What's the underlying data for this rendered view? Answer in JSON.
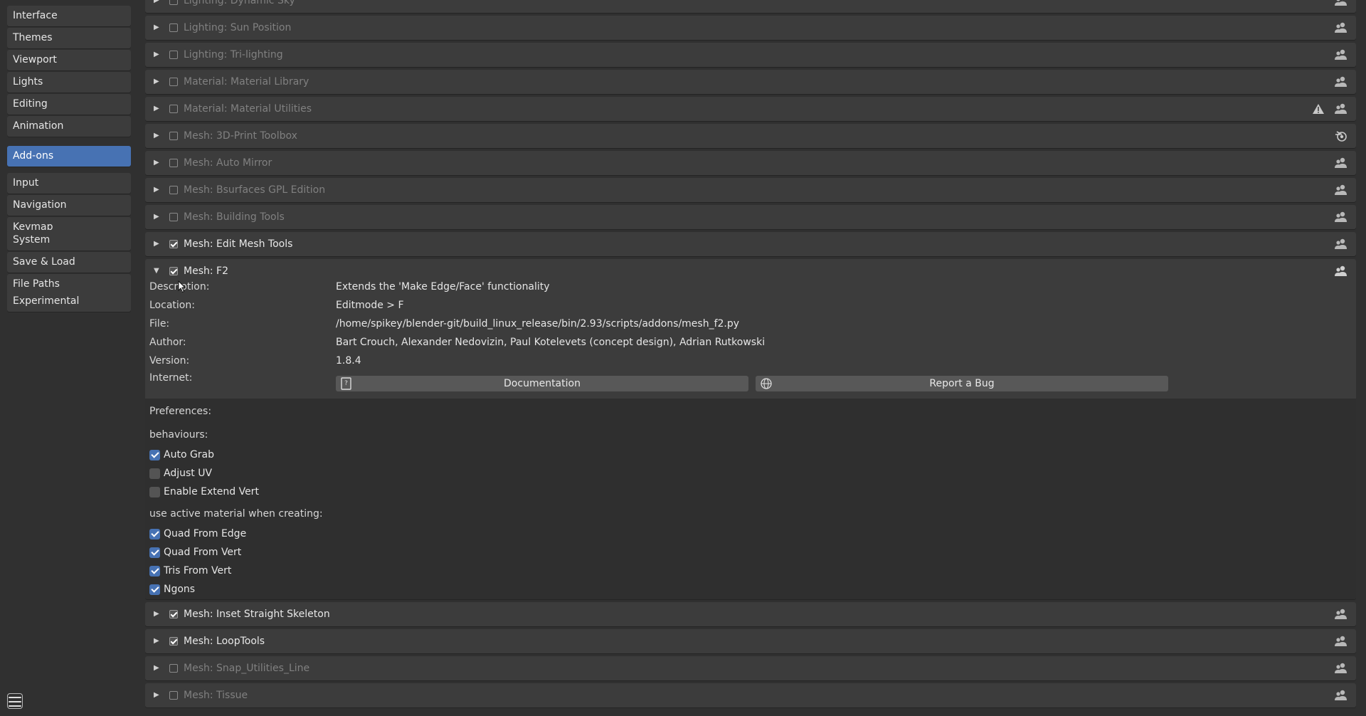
{
  "sidebar": {
    "groups": [
      [
        "Interface",
        "Themes",
        "Viewport",
        "Lights",
        "Editing",
        "Animation"
      ],
      [
        "Add-ons"
      ],
      [
        "Input",
        "Navigation",
        "Keymap"
      ],
      [
        "System",
        "Save & Load",
        "File Paths"
      ],
      [
        "Experimental"
      ]
    ],
    "active": "Add-ons"
  },
  "addons_above": [
    {
      "name": "Lighting: Dynamic Sky",
      "enabled": false,
      "icon": "community-icon"
    },
    {
      "name": "Lighting: Sun Position",
      "enabled": false,
      "icon": "community-icon"
    },
    {
      "name": "Lighting: Tri-lighting",
      "enabled": false,
      "icon": "community-icon"
    },
    {
      "name": "Material: Material Library",
      "enabled": false,
      "icon": "community-icon"
    },
    {
      "name": "Material: Material Utilities",
      "enabled": false,
      "icon": "community-icon",
      "warning": true
    },
    {
      "name": "Mesh: 3D-Print Toolbox",
      "enabled": false,
      "icon": "blender-official-icon"
    },
    {
      "name": "Mesh: Auto Mirror",
      "enabled": false,
      "icon": "community-icon"
    },
    {
      "name": "Mesh: Bsurfaces GPL Edition",
      "enabled": false,
      "icon": "community-icon"
    },
    {
      "name": "Mesh: Building Tools",
      "enabled": false,
      "icon": "community-icon"
    },
    {
      "name": "Mesh: Edit Mesh Tools",
      "enabled": true,
      "icon": "community-icon"
    }
  ],
  "expanded": {
    "name": "Mesh: F2",
    "enabled": true,
    "info": [
      {
        "label": "Description:",
        "value": "Extends the 'Make Edge/Face' functionality"
      },
      {
        "label": "Location:",
        "value": "Editmode > F"
      },
      {
        "label": "File:",
        "value": "/home/spikey/blender-git/build_linux_release/bin/2.93/scripts/addons/mesh_f2.py"
      },
      {
        "label": "Author:",
        "value": "Bart Crouch, Alexander Nedovizin, Paul Kotelevets (concept design), Adrian Rutkowski"
      },
      {
        "label": "Version:",
        "value": "1.8.4"
      }
    ],
    "internet_label": "Internet:",
    "documentation_label": "Documentation",
    "report_bug_label": "Report a Bug",
    "preferences_label": "Preferences:",
    "behaviours_label": "behaviours:",
    "behaviours": [
      {
        "label": "Auto Grab",
        "checked": true
      },
      {
        "label": "Adjust UV",
        "checked": false
      },
      {
        "label": "Enable Extend Vert",
        "checked": false
      }
    ],
    "material_label": "use active material when creating:",
    "material_options": [
      {
        "label": "Quad From Edge",
        "checked": true
      },
      {
        "label": "Quad From Vert",
        "checked": true
      },
      {
        "label": "Tris From Vert",
        "checked": true
      },
      {
        "label": "Ngons",
        "checked": true
      }
    ]
  },
  "addons_below": [
    {
      "name": "Mesh: Inset Straight Skeleton",
      "enabled": true,
      "icon": "community-icon"
    },
    {
      "name": "Mesh: LoopTools",
      "enabled": true,
      "icon": "community-icon"
    },
    {
      "name": "Mesh: Snap_Utilities_Line",
      "enabled": false,
      "icon": "community-icon"
    },
    {
      "name": "Mesh: Tissue",
      "enabled": false,
      "icon": "community-icon"
    }
  ],
  "colors": {
    "accent": "#4772b3",
    "background": "#303030",
    "row": "#3c3c3c"
  }
}
